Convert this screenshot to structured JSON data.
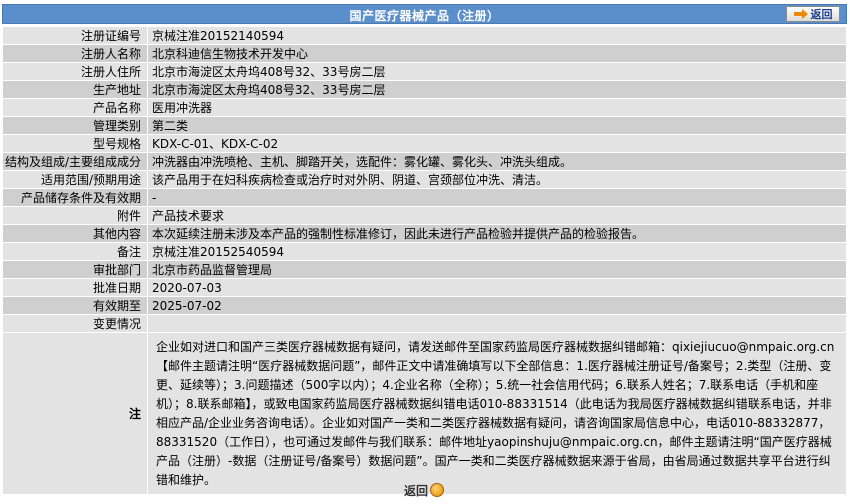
{
  "header": {
    "title": "国产医疗器械产品（注册）",
    "back_label": "返回"
  },
  "rows": [
    {
      "label": "注册证编号",
      "value": "京械注准20152140594"
    },
    {
      "label": "注册人名称",
      "value": "北京科迪信生物技术开发中心"
    },
    {
      "label": "注册人住所",
      "value": "北京市海淀区太舟坞408号32、33号房二层"
    },
    {
      "label": "生产地址",
      "value": "北京市海淀区太舟坞408号32、33号房二层"
    },
    {
      "label": "产品名称",
      "value": "医用冲洗器"
    },
    {
      "label": "管理类别",
      "value": "第二类"
    },
    {
      "label": "型号规格",
      "value": "KDX-C-01、KDX-C-02"
    },
    {
      "label": "结构及组成/主要组成成分",
      "value": "冲洗器由冲洗喷枪、主机、脚踏开关，选配件：雾化罐、雾化头、冲洗头组成。"
    },
    {
      "label": "适用范围/预期用途",
      "value": "该产品用于在妇科疾病检查或治疗时对外阴、阴道、宫颈部位冲洗、清洁。"
    },
    {
      "label": "产品储存条件及有效期",
      "value": "-"
    },
    {
      "label": "附件",
      "value": "产品技术要求"
    },
    {
      "label": "其他内容",
      "value": "本次延续注册未涉及本产品的强制性标准修订，因此未进行产品检验并提供产品的检验报告。"
    },
    {
      "label": "备注",
      "value": "京械注准20152540594"
    },
    {
      "label": "审批部门",
      "value": "北京市药品监督管理局"
    },
    {
      "label": "批准日期",
      "value": "2020-07-03"
    },
    {
      "label": "有效期至",
      "value": "2025-07-02"
    }
  ],
  "changes": {
    "label": "变更情况",
    "value": ""
  },
  "note": {
    "label": "注",
    "text": "企业如对进口和国产三类医疗器械数据有疑问，请发送邮件至国家药监局医疗器械数据纠错邮箱：qixiejiucuo@nmpaic.org.cn【邮件主题请注明“医疗器械数据问题”，邮件正文中请准确填写以下全部信息：1.医疗器械注册证号/备案号；2.类型（注册、变更、延续等）；3.问题描述（500字以内）；4.企业名称（全称）；5.统一社会信用代码；6.联系人姓名；7.联系电话（手机和座机）；8.联系邮箱】，或致电国家药监局医疗器械数据纠错电话010-88331514（此电话为我局医疗器械数据纠错联系电话，并非相应产品/企业业务咨询电话）。企业如对国产一类和二类医疗器械数据有疑问，请咨询国家局信息中心，电话010-88332877，88331520（工作日），也可通过发邮件与我们联系：邮件地址yaopinshuju@nmpaic.org.cn，邮件主题请注明“国产医疗器械产品（注册）-数据（注册证号/备案号）数据问题”。国产一类和二类医疗器械数据来源于省局，由省局通过数据共享平台进行纠错和维护。"
  },
  "footer": {
    "back_label": "返回"
  }
}
